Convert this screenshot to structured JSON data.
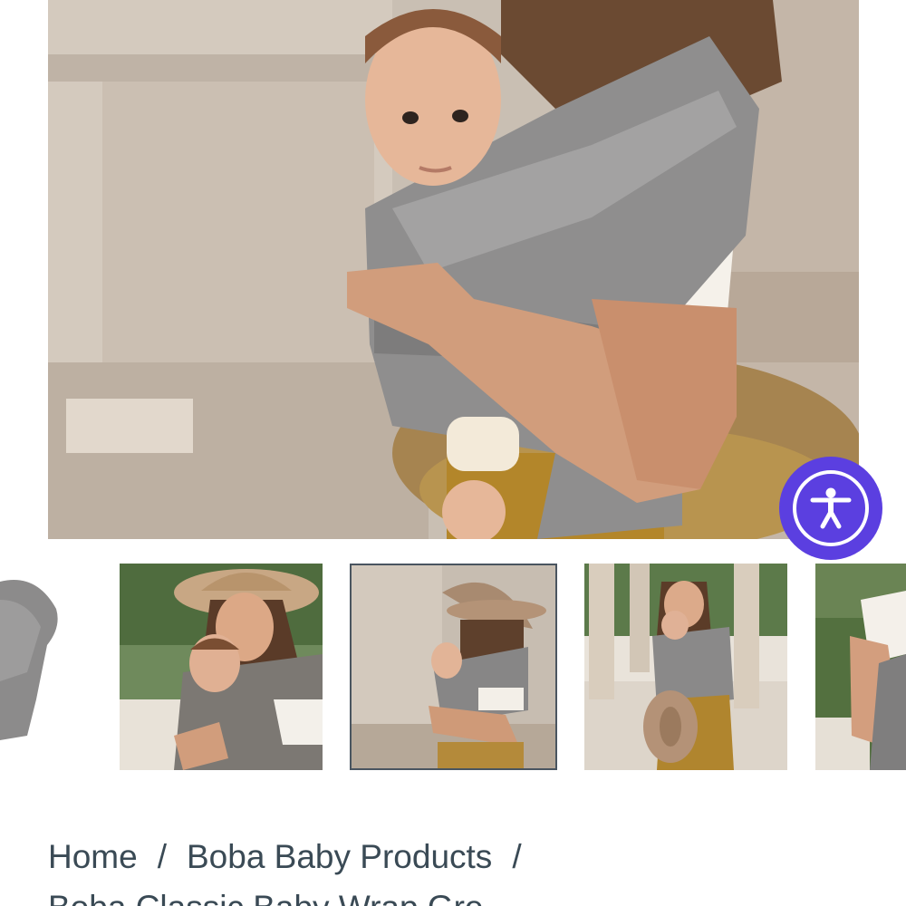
{
  "gallery": {
    "main_image_alt": "Woman wearing baby in grey wrap carrier",
    "thumbnails": [
      {
        "alt": "Grey wrap carrier product"
      },
      {
        "alt": "Smiling woman in hat with baby in wrap"
      },
      {
        "alt": "Woman in hat with baby in wrap by column"
      },
      {
        "alt": "Woman holding hat with baby in wrap on terrace"
      },
      {
        "alt": "Woman with baby in wrap outdoors"
      }
    ],
    "active_thumbnail": 3
  },
  "accessibility": {
    "label": "Accessibility menu",
    "icon": "accessibility-person-icon",
    "color": "#5b3fe0"
  },
  "breadcrumb": {
    "home": "Home",
    "separator": "/",
    "collection": "Boba Baby Products",
    "current": "Boba Classic Baby Wrap Gre"
  }
}
